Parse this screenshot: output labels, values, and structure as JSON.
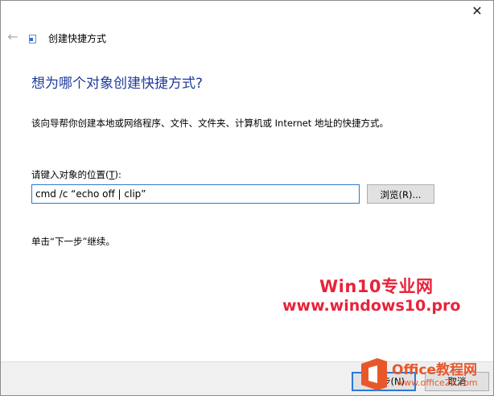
{
  "window": {
    "close_glyph": "✕"
  },
  "nav": {
    "back_glyph": "←"
  },
  "wizard": {
    "title": "创建快捷方式",
    "heading": "想为哪个对象创建快捷方式?",
    "description": "该向导帮你创建本地或网络程序、文件、文件夹、计算机或 Internet 地址的快捷方式。",
    "field_label": "请键入对象的位置(",
    "field_label_accesskey": "T",
    "field_label_end": "):",
    "input_value": "cmd /c “echo off | clip”",
    "browse_label": "浏览(R)...",
    "hint": "单击“下一步”继续。"
  },
  "footer": {
    "next_label": "下一步(N)",
    "cancel_label": "取消"
  },
  "watermark": {
    "line1": "Win10专业网",
    "line2": "www.windows10.pro",
    "logo_name": "Office教程网",
    "logo_url": "www.office26.com"
  },
  "colors": {
    "heading": "#1f3b9c",
    "focus_border": "#2b78d6",
    "watermark_red": "#e8233a",
    "logo_orange": "#e8572a"
  }
}
